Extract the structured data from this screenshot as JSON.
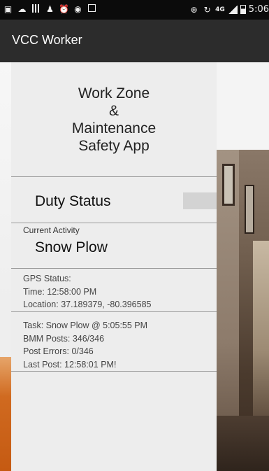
{
  "status_bar": {
    "time": "5:06",
    "network_label": "4G",
    "icons": [
      "image-icon",
      "cloud-upload-icon",
      "barcode-icon",
      "person-icon",
      "alarm-icon",
      "app-icon",
      "gps-icon",
      "rotate-icon",
      "signal-icon",
      "battery-icon"
    ]
  },
  "action_bar": {
    "title": "VCC Worker"
  },
  "heading": {
    "line1": "Work Zone",
    "line2": "&",
    "line3": "Maintenance",
    "line4": "Safety App"
  },
  "duty": {
    "label": "Duty Status",
    "toggle_on": false
  },
  "activity": {
    "caption": "Current Activity",
    "value": "Snow Plow"
  },
  "gps": {
    "status": "GPS Status:",
    "time": "Time: 12:58:00 PM",
    "location": "Location: 37.189379, -80.396585"
  },
  "stats": {
    "task": "Task: Snow Plow @ 5:05:55 PM",
    "bmm_posts": "BMM Posts:  346/346",
    "post_errors": "Post Errors: 0/346",
    "last_post": "Last Post: 12:58:01 PM!"
  },
  "colors": {
    "status_bar_bg": "#0b0b0b",
    "action_bar_bg": "#2c2c2c",
    "panel_bg": "#ededed",
    "divider": "#9a9a9a"
  }
}
